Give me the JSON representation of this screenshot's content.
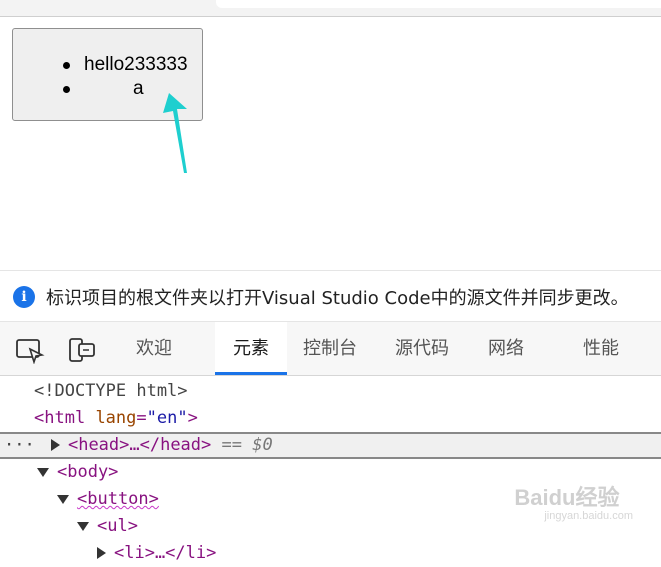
{
  "page": {
    "button": {
      "items": [
        "hello233333",
        "a"
      ]
    }
  },
  "info_bar": {
    "message": "标识项目的根文件夹以打开Visual Studio Code中的源文件并同步更改。"
  },
  "devtools": {
    "tabs": [
      {
        "label": "欢迎"
      },
      {
        "label": "元素"
      },
      {
        "label": "控制台"
      },
      {
        "label": "源代码"
      },
      {
        "label": "网络"
      },
      {
        "label": "性能"
      }
    ],
    "active_tab": "元素",
    "tree": {
      "doctype": "<!DOCTYPE html>",
      "html_open": "<html",
      "html_attr_name": "lang",
      "html_attr_value": "\"en\"",
      "head": "<head>…</head>",
      "selected_marker": "== $0",
      "ellipsis": "···",
      "body": "<body>",
      "button": "<button>",
      "ul": "<ul>",
      "li": "<li>…</li>"
    }
  },
  "watermark": {
    "text": "Baidu经验",
    "sub": "jingyan.baidu.com"
  },
  "colors": {
    "accent": "#1a73e8",
    "arrow": "#1ecfcf",
    "tag": "#881280"
  }
}
